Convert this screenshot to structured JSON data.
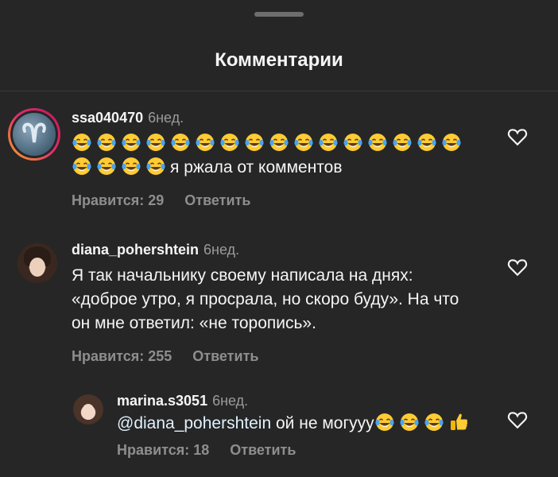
{
  "sheet": {
    "title": "Комментарии"
  },
  "comments": [
    {
      "username": "ssa040470",
      "time": "6нед.",
      "text": "я ржала от комментов",
      "emoji_count_before_text": 20,
      "emoji": "face-with-tears-of-joy",
      "likes_label": "Нравится: 29",
      "reply_label": "Ответить",
      "has_story_ring": true
    },
    {
      "username": "diana_pohershtein",
      "time": "6нед.",
      "text": "Я так начальнику своему написала на днях: «доброе утро, я просрала, но скоро буду». На что он мне ответил: «не торопись».",
      "likes_label": "Нравится: 255",
      "reply_label": "Ответить"
    },
    {
      "username": "marina.s3051",
      "time": "6нед.",
      "mention": "@diana_pohershtein",
      "text": " ой не могууу",
      "emoji_after_text": [
        "face-with-tears-of-joy",
        "face-with-tears-of-joy",
        "face-with-tears-of-joy",
        "thumbs-up"
      ],
      "likes_label": "Нравится: 18",
      "reply_label": "Ответить"
    }
  ],
  "colors": {
    "background": "#262626",
    "text": "#f5f5f5",
    "secondary": "#8e8e8e",
    "story_ring_start": "#f9a825",
    "story_ring_end": "#c2185b"
  }
}
